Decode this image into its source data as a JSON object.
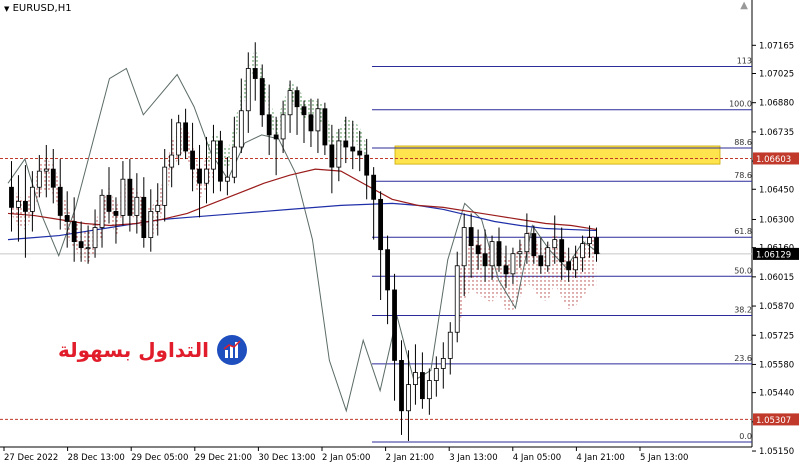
{
  "window": {
    "symbol": "EURUSD,H1"
  },
  "brand": {
    "text": "التداول بسهولة",
    "colors": {
      "primary": "#1f4fbf",
      "accent": "#e11d2b"
    }
  },
  "chart_data": {
    "type": "candlestick",
    "symbol": "EURUSD",
    "timeframe": "H1",
    "y_range": [
      1.0517,
      1.0739
    ],
    "y_ticks": [
      "1.07165",
      "1.07025",
      "1.06880",
      "1.06735",
      "1.06590",
      "1.06450",
      "1.06300",
      "1.06160",
      "1.06015",
      "1.05870",
      "1.05725",
      "1.05580",
      "1.05440",
      "1.05295",
      "1.05150"
    ],
    "x_labels": [
      "27 Dec 2022",
      "28 Dec 13:00",
      "29 Dec 05:00",
      "29 Dec 21:00",
      "30 Dec 13:00",
      "2 Jan 05:00",
      "2 Jan 21:00",
      "3 Jan 13:00",
      "4 Jan 05:00",
      "4 Jan 21:00",
      "5 Jan 13:00"
    ],
    "price_labels": [
      {
        "value": "1.06603",
        "kind": "level",
        "color": "#c0392b"
      },
      {
        "value": "1.06129",
        "kind": "bid",
        "color": "#000000"
      },
      {
        "value": "1.05307",
        "kind": "level",
        "color": "#c0392b"
      }
    ],
    "fibonacci": {
      "color": "#2b2b9a",
      "levels": [
        {
          "label": "113",
          "price": 1.0706
        },
        {
          "label": "100.0",
          "price": 1.06845
        },
        {
          "label": "88.6",
          "price": 1.06655
        },
        {
          "label": "78.6",
          "price": 1.0649
        },
        {
          "label": "61.8",
          "price": 1.06212
        },
        {
          "label": "50.0",
          "price": 1.06018
        },
        {
          "label": "38.2",
          "price": 1.05823
        },
        {
          "label": "23.6",
          "price": 1.05583
        },
        {
          "label": "0.0",
          "price": 1.05195
        }
      ]
    },
    "horizontal_levels": [
      {
        "price": 1.06603,
        "style": "dashed",
        "color": "#c0392b"
      },
      {
        "price": 1.05307,
        "style": "dashed",
        "color": "#c0392b"
      },
      {
        "price": 1.06129,
        "style": "solid",
        "color": "#c8c8c8"
      }
    ],
    "highlight_zone": {
      "price_low": 1.06575,
      "price_high": 1.06665,
      "color": "#ffe44d"
    },
    "ohlc": [
      [
        1.0646,
        1.0659,
        1.0624,
        1.0636
      ],
      [
        1.0636,
        1.0652,
        1.0619,
        1.0639
      ],
      [
        1.0639,
        1.0657,
        1.0611,
        1.0634
      ],
      [
        1.0634,
        1.0654,
        1.0624,
        1.0646
      ],
      [
        1.0646,
        1.0662,
        1.0641,
        1.0654
      ],
      [
        1.0654,
        1.0667,
        1.0641,
        1.0655
      ],
      [
        1.0655,
        1.0665,
        1.0638,
        1.0646
      ],
      [
        1.0646,
        1.066,
        1.0625,
        1.0632
      ],
      [
        1.0632,
        1.0644,
        1.0616,
        1.0629
      ],
      [
        1.0629,
        1.0641,
        1.0609,
        1.0619
      ],
      [
        1.0619,
        1.0629,
        1.0609,
        1.0616
      ],
      [
        1.0616,
        1.0627,
        1.0608,
        1.0616
      ],
      [
        1.0616,
        1.0635,
        1.0611,
        1.0626
      ],
      [
        1.0626,
        1.0645,
        1.0616,
        1.0642
      ],
      [
        1.0642,
        1.0656,
        1.0628,
        1.0634
      ],
      [
        1.0634,
        1.0641,
        1.0618,
        1.0632
      ],
      [
        1.0632,
        1.0659,
        1.0627,
        1.065
      ],
      [
        1.065,
        1.066,
        1.0624,
        1.0632
      ],
      [
        1.0632,
        1.0653,
        1.0623,
        1.0641
      ],
      [
        1.0641,
        1.0651,
        1.0616,
        1.0621
      ],
      [
        1.0621,
        1.0645,
        1.0614,
        1.0634
      ],
      [
        1.0634,
        1.0648,
        1.0622,
        1.0637
      ],
      [
        1.0637,
        1.0665,
        1.0629,
        1.0656
      ],
      [
        1.0656,
        1.068,
        1.0646,
        1.0662
      ],
      [
        1.0662,
        1.0682,
        1.0657,
        1.0678
      ],
      [
        1.0678,
        1.0685,
        1.066,
        1.0664
      ],
      [
        1.0664,
        1.0678,
        1.0644,
        1.0655
      ],
      [
        1.0655,
        1.0667,
        1.0631,
        1.0648
      ],
      [
        1.0648,
        1.0671,
        1.0638,
        1.0655
      ],
      [
        1.0655,
        1.0677,
        1.0643,
        1.0669
      ],
      [
        1.0669,
        1.0674,
        1.0644,
        1.0649
      ],
      [
        1.0649,
        1.0661,
        1.0642,
        1.0651
      ],
      [
        1.0651,
        1.0681,
        1.0648,
        1.0666
      ],
      [
        1.0666,
        1.07,
        1.0663,
        1.0684
      ],
      [
        1.0684,
        1.0713,
        1.0673,
        1.0705
      ],
      [
        1.0705,
        1.0718,
        1.0689,
        1.07
      ],
      [
        1.07,
        1.0707,
        1.0676,
        1.0682
      ],
      [
        1.0682,
        1.0697,
        1.0662,
        1.0672
      ],
      [
        1.0672,
        1.0681,
        1.0652,
        1.067
      ],
      [
        1.067,
        1.0689,
        1.0663,
        1.0682
      ],
      [
        1.0682,
        1.0699,
        1.0673,
        1.0694
      ],
      [
        1.0694,
        1.0696,
        1.0672,
        1.0686
      ],
      [
        1.0686,
        1.0689,
        1.0668,
        1.0682
      ],
      [
        1.0682,
        1.069,
        1.0666,
        1.0674
      ],
      [
        1.0674,
        1.069,
        1.0663,
        1.0685
      ],
      [
        1.0685,
        1.0688,
        1.0662,
        1.0667
      ],
      [
        1.0667,
        1.0677,
        1.0643,
        1.0656
      ],
      [
        1.0656,
        1.0675,
        1.0649,
        1.0669
      ],
      [
        1.0669,
        1.0681,
        1.0658,
        1.0666
      ],
      [
        1.0666,
        1.0679,
        1.0655,
        1.0664
      ],
      [
        1.0664,
        1.0674,
        1.0654,
        1.0662
      ],
      [
        1.0662,
        1.067,
        1.064,
        1.0652
      ],
      [
        1.0652,
        1.0656,
        1.062,
        1.064
      ],
      [
        1.064,
        1.0644,
        1.059,
        1.0615
      ],
      [
        1.0615,
        1.0622,
        1.0578,
        1.0595
      ],
      [
        1.0595,
        1.0603,
        1.054,
        1.056
      ],
      [
        1.056,
        1.057,
        1.0523,
        1.0535
      ],
      [
        1.0535,
        1.0565,
        1.052,
        1.0548
      ],
      [
        1.0548,
        1.0568,
        1.0538,
        1.0554
      ],
      [
        1.0554,
        1.0564,
        1.0536,
        1.0541
      ],
      [
        1.0541,
        1.0556,
        1.0533,
        1.055
      ],
      [
        1.055,
        1.0562,
        1.0542,
        1.0556
      ],
      [
        1.0556,
        1.0569,
        1.0546,
        1.0561
      ],
      [
        1.0561,
        1.0579,
        1.0553,
        1.0574
      ],
      [
        1.0574,
        1.0614,
        1.0569,
        1.0607
      ],
      [
        1.0607,
        1.0633,
        1.0592,
        1.0626
      ],
      [
        1.0626,
        1.0633,
        1.0601,
        1.0617
      ],
      [
        1.0617,
        1.0625,
        1.0605,
        1.0613
      ],
      [
        1.0613,
        1.0625,
        1.0599,
        1.0607
      ],
      [
        1.0607,
        1.0622,
        1.06,
        1.0619
      ],
      [
        1.0619,
        1.0626,
        1.0604,
        1.0607
      ],
      [
        1.0607,
        1.0617,
        1.0596,
        1.0603
      ],
      [
        1.0603,
        1.0616,
        1.0598,
        1.0613
      ],
      [
        1.0613,
        1.062,
        1.0606,
        1.0614
      ],
      [
        1.0614,
        1.0633,
        1.0608,
        1.0623
      ],
      [
        1.0623,
        1.0627,
        1.0608,
        1.0612
      ],
      [
        1.0612,
        1.0621,
        1.0603,
        1.0607
      ],
      [
        1.0607,
        1.0619,
        1.0604,
        1.0616
      ],
      [
        1.0616,
        1.0632,
        1.0608,
        1.062
      ],
      [
        1.062,
        1.0626,
        1.06,
        1.0609
      ],
      [
        1.0609,
        1.0616,
        1.0599,
        1.0605
      ],
      [
        1.0605,
        1.0617,
        1.0601,
        1.0611
      ],
      [
        1.0611,
        1.0622,
        1.0604,
        1.0618
      ],
      [
        1.0618,
        1.0627,
        1.0611,
        1.0621
      ],
      [
        1.0621,
        1.0626,
        1.0609,
        1.0613
      ]
    ],
    "ema_slow": [
      1.062,
      1.0621,
      1.0622,
      1.0624,
      1.0626,
      1.0628,
      1.063,
      1.0631,
      1.0632,
      1.0633,
      1.0634,
      1.0635,
      1.0636,
      1.0637,
      1.06375,
      1.0638,
      1.0637,
      1.0635,
      1.0632,
      1.0629,
      1.0627,
      1.06255,
      1.0625,
      1.06245
    ],
    "ema_fast": [
      1.0633,
      1.0632,
      1.063,
      1.0628,
      1.0627,
      1.0628,
      1.063,
      1.0633,
      1.0638,
      1.0643,
      1.0648,
      1.0652,
      1.0655,
      1.0654,
      1.0647,
      1.064,
      1.0637,
      1.0636,
      1.0634,
      1.0632,
      1.063,
      1.0628,
      1.0627,
      1.0625
    ],
    "grey_oscillator": [
      1.0648,
      1.066,
      1.0632,
      1.0612,
      1.0636,
      1.0668,
      1.07,
      1.0705,
      1.0682,
      1.0692,
      1.0702,
      1.0686,
      1.0663,
      1.065,
      1.0668,
      1.0672,
      1.067,
      1.0653,
      1.062,
      1.056,
      1.0535,
      1.057,
      1.0545,
      1.0582,
      1.055,
      1.0555,
      1.061,
      1.0638,
      1.063,
      1.06,
      1.0586,
      1.0627,
      1.0615,
      1.0606,
      1.0619,
      1.0613
    ]
  }
}
